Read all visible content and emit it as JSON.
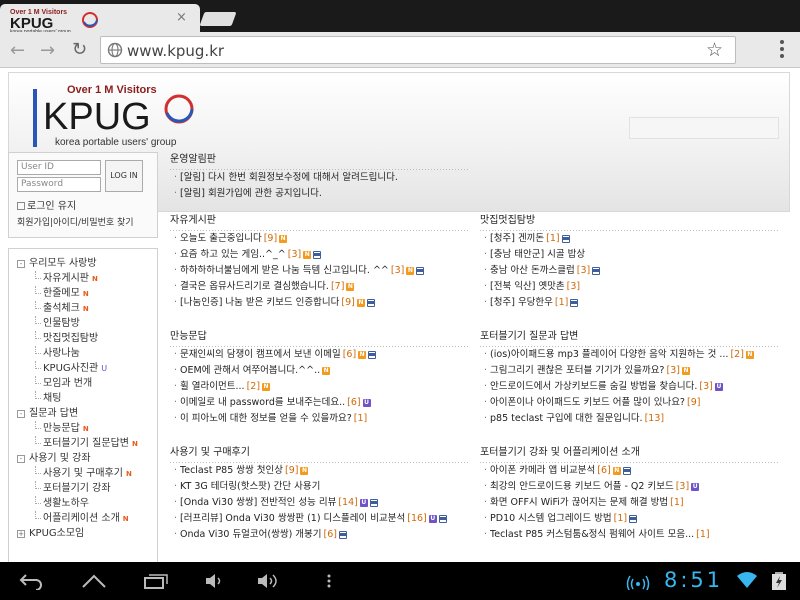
{
  "browser": {
    "tab_title": "KPUG",
    "url": "www.kpug.kr",
    "tab_close": "×"
  },
  "logo": {
    "tagline_top": "Over 1 M Visitors",
    "name": "KPUG",
    "subtitle": "korea portable users' group"
  },
  "sidebar": {
    "user_id_placeholder": "User ID",
    "password_placeholder": "Password",
    "login_button": "LOG IN",
    "keep_login": "로그인 유지",
    "signup_link": "회원가입",
    "find_link": "아이디/비밀번호 찾기",
    "tree": [
      {
        "label": "우리모두 사랑방",
        "level": 0,
        "box": "-"
      },
      {
        "label": "자유게시판",
        "level": 1,
        "tag": "N"
      },
      {
        "label": "한줄메모",
        "level": 1,
        "tag": "N"
      },
      {
        "label": "출석체크",
        "level": 1,
        "tag": "N"
      },
      {
        "label": "인물탐방",
        "level": 1
      },
      {
        "label": "맛집멋집탐방",
        "level": 1
      },
      {
        "label": "사랑나눔",
        "level": 1
      },
      {
        "label": "KPUG사진관",
        "level": 1,
        "tag": "U"
      },
      {
        "label": "모임과 번개",
        "level": 1
      },
      {
        "label": "채팅",
        "level": 1
      },
      {
        "label": "질문과 답변",
        "level": 0,
        "box": "-"
      },
      {
        "label": "만능문답",
        "level": 1,
        "tag": "N"
      },
      {
        "label": "포터블기기 질문답변",
        "level": 1,
        "tag": "N"
      },
      {
        "label": "사용기 및 강좌",
        "level": 0,
        "box": "-"
      },
      {
        "label": "사용기 및 구매후기",
        "level": 1,
        "tag": "N"
      },
      {
        "label": "포터블기기 강좌",
        "level": 1
      },
      {
        "label": "생활노하우",
        "level": 1
      },
      {
        "label": "어플리케이션 소개",
        "level": 1,
        "tag": "N"
      },
      {
        "label": "KPUG소모임",
        "level": 0,
        "box": "+"
      }
    ]
  },
  "sections": {
    "notice": {
      "title": "운영알림판",
      "posts": [
        {
          "text": "[알림] 다시 한번 회원정보수정에 대해서 알려드립니다."
        },
        {
          "text": "[알림] 회원가입에 관한 공지입니다."
        }
      ]
    },
    "free": {
      "title": "자유게시판",
      "posts": [
        {
          "text": "오늘도 출근중입니다",
          "count": "[9]",
          "badges": [
            "N"
          ]
        },
        {
          "text": "요즘 하고 있는 게임..^_^",
          "count": "[3]",
          "badges": [
            "N",
            "IMG"
          ]
        },
        {
          "text": "하하하하너불님에게 받은 나눔 득템 신고입니다. ^^",
          "count": "[3]",
          "badges": [
            "N",
            "IMG"
          ]
        },
        {
          "text": "결국은 옵뮤사드리기로 결심했습니다.",
          "count": "[7]",
          "badges": [
            "N"
          ]
        },
        {
          "text": "[나눔인증] 나눔 받은 키보드 인증합니다",
          "count": "[9]",
          "badges": [
            "N",
            "IMG"
          ]
        }
      ]
    },
    "food": {
      "title": "맛집멋집탐방",
      "posts": [
        {
          "text": "[청주] 겐끼돈",
          "count": "[1]",
          "badges": [
            "IMG"
          ]
        },
        {
          "text": "[충남 태안군] 시골 밥상"
        },
        {
          "text": "충남 아산 돈까스클럽",
          "count": "[3]",
          "badges": [
            "IMG"
          ]
        },
        {
          "text": "[전북 익산] 옛맛촌",
          "count": "[3]"
        },
        {
          "text": "[청주] 우당한우",
          "count": "[1]",
          "badges": [
            "IMG"
          ]
        }
      ]
    },
    "qna": {
      "title": "만능문답",
      "posts": [
        {
          "text": "문재인씨의 담쟁이 캠프에서 보낸 이메일",
          "count": "[6]",
          "badges": [
            "N",
            "IMG"
          ]
        },
        {
          "text": "OEM에 관해서 여쭈어봅니다.^^..",
          "badges": [
            "N"
          ]
        },
        {
          "text": "휠 열라이먼트...",
          "count": "[2]",
          "badges": [
            "N"
          ]
        },
        {
          "text": "이메일로 내 password를 보내주는데요..",
          "count": "[6]",
          "badges": [
            "U"
          ]
        },
        {
          "text": "이 피아노에 대한 정보를 얻을 수 있을까요?",
          "count": "[1]"
        }
      ]
    },
    "portable_qna": {
      "title": "포터블기기 질문과 답변",
      "posts": [
        {
          "text": "(ios)아이패드용 mp3 플레이어 다양한 음악 지원하는 것 ...",
          "count": "[2]",
          "badges": [
            "N"
          ]
        },
        {
          "text": "그림그리기 괜찮은 포터블 기기가 있을까요?",
          "count": "[3]",
          "badges": [
            "N"
          ]
        },
        {
          "text": "안드로이드에서 가상키보드를 숨길 방법을 찾습니다.",
          "count": "[3]",
          "badges": [
            "U"
          ]
        },
        {
          "text": "아이폰이나 아이패드도 키보드 어플 많이 있나요?",
          "count": "[9]"
        },
        {
          "text": "p85 teclast 구입에 대한 질문입니다.",
          "count": "[13]"
        }
      ]
    },
    "review": {
      "title": "사용기 및 구매후기",
      "posts": [
        {
          "text": "Teclast P85 쌍쌍 첫인상",
          "count": "[9]",
          "badges": [
            "N"
          ]
        },
        {
          "text": "KT 3G 테더링(핫스팟) 간단 사용기"
        },
        {
          "text": "[Onda Vi30 쌍쌍] 전반적인 성능 리뷰",
          "count": "[14]",
          "badges": [
            "U",
            "IMG"
          ]
        },
        {
          "text": "[러프리뷰] Onda Vi30 쌍쌍판 (1) 디스플레이 비교분석",
          "count": "[16]",
          "badges": [
            "U",
            "IMG"
          ]
        },
        {
          "text": "Onda Vi30 듀얼코어(쌍쌍) 개봉기",
          "count": "[6]",
          "badges": [
            "IMG"
          ]
        }
      ]
    },
    "apps": {
      "title": "포터블기기 강좌 및 어플리케이션 소개",
      "posts": [
        {
          "text": "아이폰 카메라 앱 비교분석",
          "count": "[6]",
          "badges": [
            "N",
            "IMG"
          ]
        },
        {
          "text": "최강의 안드로이드용 키보드 어플 - Q2 키보드",
          "count": "[3]",
          "badges": [
            "U"
          ]
        },
        {
          "text": "화면 OFF시 WiFi가 끊어지는 문제 해결 방법",
          "count": "[1]"
        },
        {
          "text": "PD10 시스템 업그레이드 방법",
          "count": "[1]",
          "badges": [
            "IMG"
          ]
        },
        {
          "text": "Teclast P85 커스텀툼&정식 펌웨어 사이트 모음...",
          "count": "[1]"
        }
      ]
    }
  },
  "system_bar": {
    "time": "8:51",
    "accent": "#38b6f0"
  }
}
